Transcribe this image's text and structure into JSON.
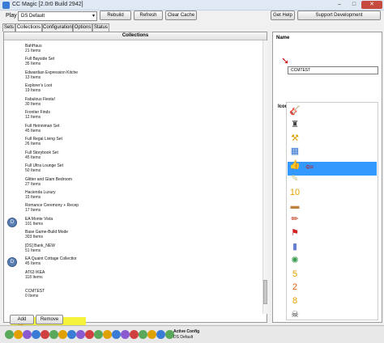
{
  "window": {
    "title": "CC Magic [2.0r0 Build 2942]",
    "min": "–",
    "max": "□",
    "close": "✕"
  },
  "toolbar": {
    "play_label": "Play",
    "play_value": "DS Default",
    "rebuild": "Rebuild",
    "refresh": "Refresh",
    "clear_cache": "Clear Cache",
    "get_help": "Get Help",
    "support": "Support Development"
  },
  "tabs": [
    "Sets",
    "Collections",
    "Configurations",
    "Options",
    "Status"
  ],
  "collections": {
    "header": "Collections",
    "items": [
      {
        "name": "BahHaus",
        "count": "21 Items"
      },
      {
        "name": "Full Bayside Set",
        "count": "35 Items"
      },
      {
        "name": "Edwardian Expression Kitche",
        "count": "13 Items"
      },
      {
        "name": "Explorer's Loot",
        "count": "19 Items"
      },
      {
        "name": "Fabulous Fiesta!",
        "count": "30 Items"
      },
      {
        "name": "Frontier Finds",
        "count": "12 Items"
      },
      {
        "name": "Full Heinniman Set",
        "count": "45 Items"
      },
      {
        "name": "Full Regal Living Set",
        "count": "26 Items"
      },
      {
        "name": "Full Storybook Set",
        "count": "45 Items"
      },
      {
        "name": "Full Ultra Lounge Set",
        "count": "50 Items"
      },
      {
        "name": "Glitter and Glam Bedroom",
        "count": "27 Items"
      },
      {
        "name": "Hacienda Luxury",
        "count": "15 Items"
      },
      {
        "name": "Romance Ceremony + Recep",
        "count": "17 Items"
      },
      {
        "name": "EA Monte Vista",
        "count": "101 Items"
      },
      {
        "name": "Base Game-Build Mode",
        "count": "303 Items"
      },
      {
        "name": "[DS] Bank_NEW",
        "count": "51 Items"
      },
      {
        "name": "EA Quaint Cottage Collectior",
        "count": "45 Items"
      },
      {
        "name": "AT63 IKEA",
        "count": "118 Items"
      },
      {
        "name": "CCMTEST",
        "count": "0 Items"
      }
    ],
    "add": "Add",
    "remove": "Remove"
  },
  "details": {
    "name_label": "Name",
    "name_value": "CCMTEST",
    "icon_label": "Icon",
    "icons": [
      "guitar-icon",
      "hydrant-icon",
      "tools-icon",
      "blocks-icon",
      "thumbs-up-icon",
      "feather-icon",
      "ten-icon",
      "bus-icon",
      "syringe-icon",
      "flag-icon",
      "bottle-icon",
      "atom-icon",
      "five-icon",
      "two-icon",
      "eight-icon",
      "pirate-icon"
    ],
    "icon_glyphs": [
      "🎸",
      "♜",
      "⚒",
      "▦",
      "👍",
      "✎",
      "10",
      "▬",
      "✏",
      "⚑",
      "▮",
      "✺",
      "5",
      "2",
      "8",
      "☠"
    ],
    "icon_colors": [
      "#a0522d",
      "#444",
      "#d8a000",
      "#2f6fd0",
      "#b07a2a",
      "#c9c48a",
      "#e0a000",
      "#c08040",
      "#c04020",
      "#d02020",
      "#6a7fd0",
      "#3a9a50",
      "#e0a000",
      "#e06010",
      "#e0a000",
      "#333"
    ]
  },
  "status": {
    "line1": "Active Config",
    "line2": "DS Default",
    "icon_colors": [
      "#5aa85a",
      "#e0a000",
      "#8a5ad0",
      "#3a7bd5",
      "#d04040",
      "#5aa85a",
      "#e0a000",
      "#3a7bd5",
      "#8a5ad0",
      "#d04040",
      "#5aa85a",
      "#e0a000",
      "#3a7bd5",
      "#8a5ad0",
      "#d04040",
      "#5aa85a",
      "#e0a000",
      "#3a7bd5",
      "#5aa85a"
    ]
  }
}
